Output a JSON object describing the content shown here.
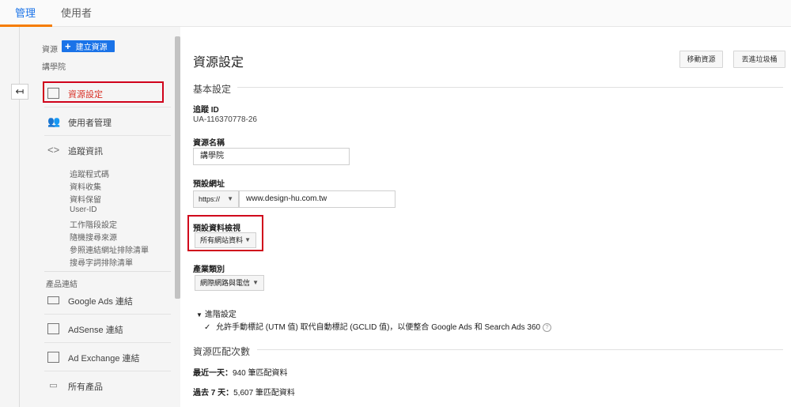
{
  "tabs": {
    "admin": "管理",
    "user": "使用者"
  },
  "sidebar": {
    "resource_label": "資源",
    "create_button": "建立資源",
    "property_name": "講學院",
    "back_arrow": "↤",
    "nav": {
      "property_settings": "資源設定",
      "user_management": "使用者管理",
      "tracking_info": "追蹤資訊"
    },
    "tracking_sub": [
      "追蹤程式碼",
      "資料收集",
      "資料保留",
      "User-ID",
      "工作階段設定",
      "隨機搜尋來源",
      "參照連結網址排除清單",
      "搜尋字詞排除清單"
    ],
    "product_links_label": "產品連結",
    "product_links": [
      "Google Ads 連結",
      "AdSense 連結",
      "Ad Exchange 連結",
      "所有產品"
    ]
  },
  "main": {
    "title": "資源設定",
    "move_button": "移動資源",
    "trash_button": "丟進垃圾桶",
    "basic_settings": "基本設定",
    "tracking_id_label": "追蹤 ID",
    "tracking_id_value": "UA-116370778-26",
    "property_name_label": "資源名稱",
    "property_name_value": "講學院",
    "default_url_label": "預設網址",
    "protocol_value": "https://",
    "default_url_value": "www.design-hu.com.tw",
    "default_view_label": "預設資料檢視",
    "default_view_value": "所有網站資料",
    "industry_label": "產業類別",
    "industry_value": "網際網路與電信",
    "advanced_label": "進階設定",
    "advanced_checkbox_text": "允許手動標記 (UTM 值) 取代自動標記 (GCLID 值)，以便整合 Google Ads 和 Search Ads 360",
    "match_count_header": "資源匹配次數",
    "last_day_label": "最近一天：",
    "last_day_value": "940 筆匹配資料",
    "last_7_label": "過去 7 天：",
    "last_7_value": "5,607 筆匹配資料"
  },
  "colors": {
    "accent_blue": "#1a73e8",
    "highlight_red": "#d0021b",
    "tab_underline": "#f57c00"
  }
}
